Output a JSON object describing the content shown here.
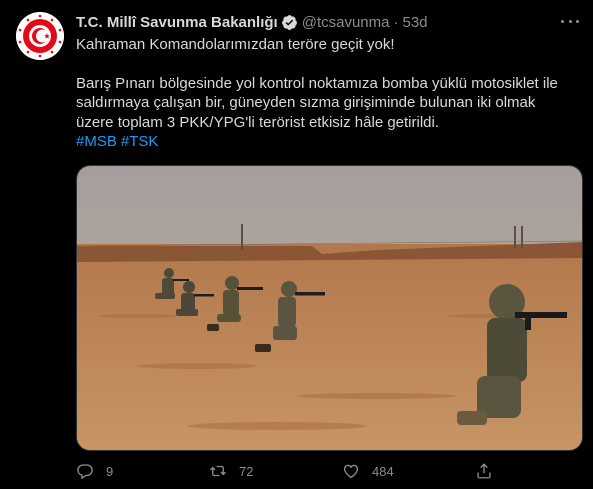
{
  "tweet": {
    "author_name": "T.C. Millî Savunma Bakanlığı",
    "handle": "@tcsavunma",
    "separator": "·",
    "time": "53d",
    "line1": "Kahraman Komandolarımızdan teröre geçit yok!",
    "paragraph": "Barış Pınarı bölgesinde yol kontrol noktamıza bomba yüklü motosiklet ile saldırmaya çalışan bir, güneyden sızma girişiminde bulunan iki olmak üzere toplam 3 PKK/YPG'li terörist etkisiz hâle getirildi.",
    "hashtags": [
      "#MSB",
      "#TSK"
    ]
  },
  "actions": {
    "reply_count": "9",
    "retweet_count": "72",
    "like_count": "484"
  },
  "icons": {
    "verified": "verified-badge-icon",
    "more": "more-icon",
    "reply": "reply-icon",
    "retweet": "retweet-icon",
    "like": "heart-icon",
    "share": "share-icon"
  },
  "colors": {
    "background": "#000000",
    "text": "#d9d9d9",
    "muted": "#8a8d91",
    "link": "#1d9bf0",
    "logo_red": "#e30a17"
  }
}
